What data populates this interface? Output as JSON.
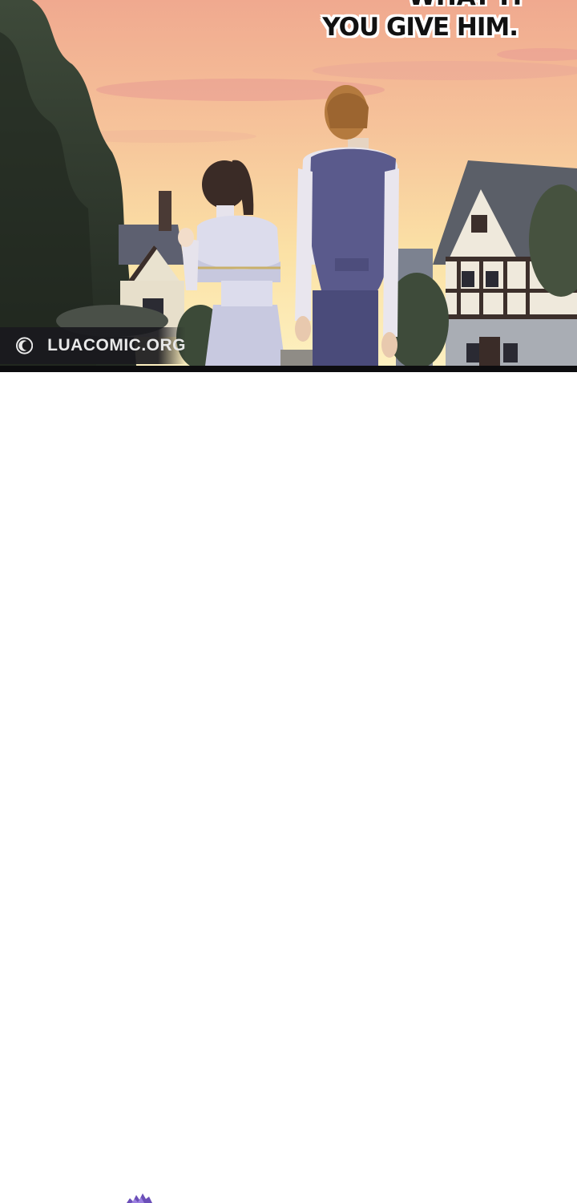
{
  "panel": {
    "dialogue_top_partial": "WHAT IT THING",
    "dialogue": "YOU GIVE HIM."
  },
  "watermark": {
    "icon": "moon-logo-icon",
    "text": "LUACOMIC.ORG"
  },
  "colors": {
    "sky_top": "#f2b49a",
    "sky_bottom": "#fbe6a8",
    "panel_border": "#0d0d0f",
    "page_background": "#ffffff"
  }
}
